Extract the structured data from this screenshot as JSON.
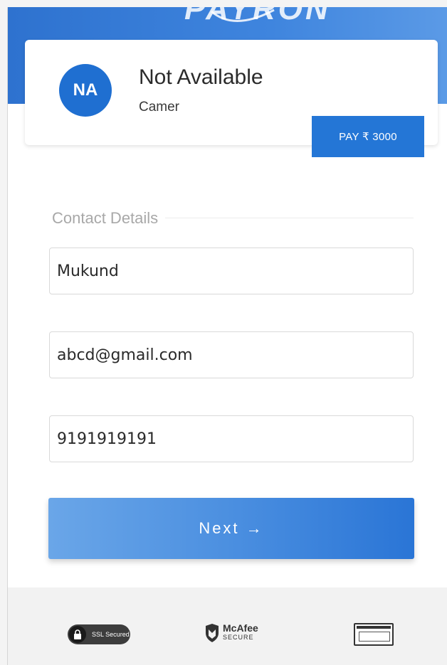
{
  "header": {
    "logo_text": "PAYRON"
  },
  "merchant": {
    "initials": "NA",
    "name": "Not Available",
    "subtitle": "Camer"
  },
  "pay_button": {
    "label": "PAY ₹ 3000"
  },
  "contact": {
    "section_title": "Contact Details",
    "name_value": "Mukund",
    "email_value": "abcd@gmail.com",
    "phone_value": "9191919191"
  },
  "next_button": {
    "label": "Next →"
  },
  "footer": {
    "ssl_label": "SSL Secured",
    "mcafee_line1": "McAfee",
    "mcafee_line2": "SECURE"
  },
  "colors": {
    "brand_blue": "#2476d6",
    "avatar_blue": "#1f6fd1"
  }
}
